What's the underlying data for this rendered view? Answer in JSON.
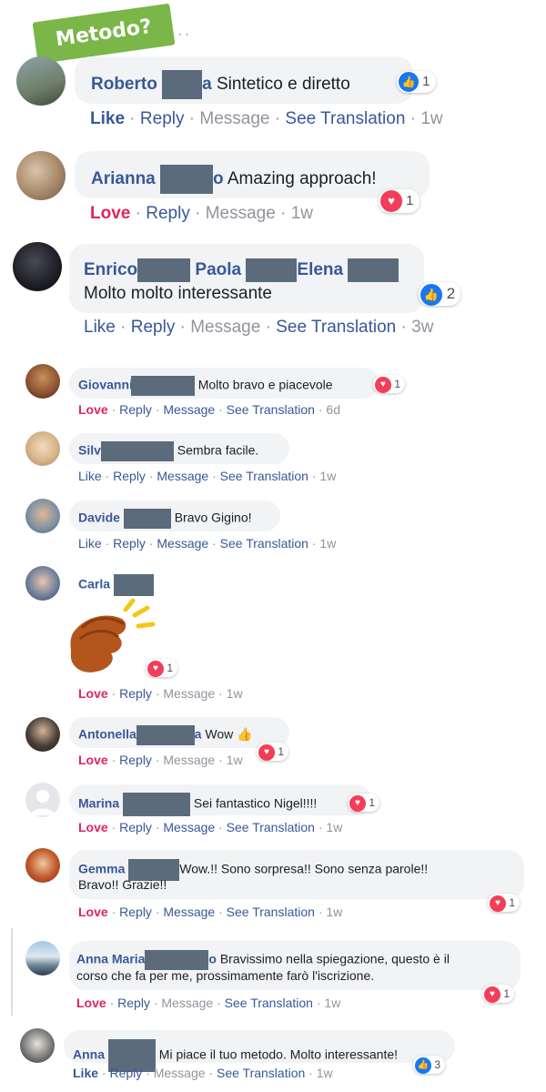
{
  "badge": {
    "label": "Metodo?"
  },
  "top_fragment": "·  ·",
  "labels": {
    "like": "Like",
    "love": "Love",
    "reply": "Reply",
    "message": "Message",
    "see_translation": "See Translation",
    "sep": " · "
  },
  "comments": [
    {
      "name": "Roberto",
      "name2": "a",
      "text": "Sintetico e diretto",
      "reaction": "like",
      "count": "1",
      "time": "1w"
    },
    {
      "name": "Arianna",
      "name2": "o",
      "text": "Amazing approach!",
      "reaction": "love",
      "count": "1",
      "time": "1w"
    },
    {
      "name": "Enrico",
      "name_b": "Paola",
      "name_c": "Elena",
      "text": "Molto molto interessante",
      "reaction": "like",
      "count": "2",
      "time": "3w"
    },
    {
      "name": "Giovanni",
      "text": "Molto bravo e piacevole",
      "reaction": "love",
      "count": "1",
      "time": "6d"
    },
    {
      "name": "Silv",
      "text": "Sembra facile.",
      "time": "1w"
    },
    {
      "name": "Davide",
      "text": "Bravo Gigino!",
      "time": "1w"
    },
    {
      "name": "Carla",
      "reaction": "love",
      "count": "1",
      "time": "1w",
      "emoji_alt": "clapping-hands"
    },
    {
      "name": "Antonella",
      "name2": "a",
      "text": "Wow 👍",
      "reaction": "love",
      "count": "1",
      "time": "1w"
    },
    {
      "name": "Marina",
      "text": "Sei fantastico Nigel!!!!",
      "reaction": "love",
      "count": "1",
      "time": "1w"
    },
    {
      "name": "Gemma",
      "text": "Wow.!! Sono sorpresa!! Sono senza parole!!",
      "text2": "Bravo!! Grazie!!",
      "reaction": "love",
      "count": "1",
      "time": "1w"
    },
    {
      "name": "Anna Maria",
      "name2": "o",
      "text": "Bravissimo nella spiegazione, questo è il",
      "text2": "corso che fa per me, prossimamente farò l'iscrizione.",
      "reaction": "love",
      "count": "1",
      "time": "1w"
    },
    {
      "name": "Anna",
      "text": "Mi piace il tuo metodo. Molto interessante!",
      "reaction": "like",
      "count": "3",
      "time": "1w"
    }
  ]
}
